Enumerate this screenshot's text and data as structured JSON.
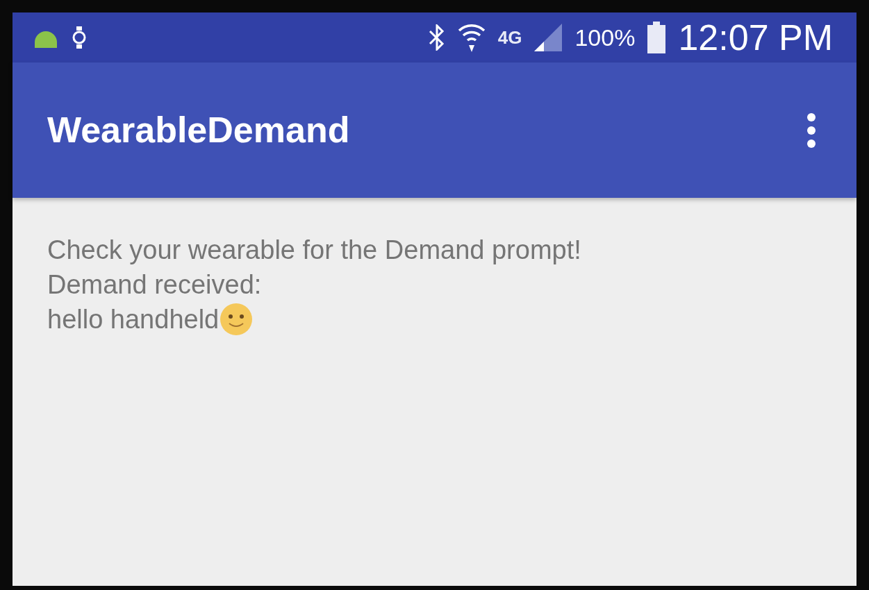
{
  "status_bar": {
    "network_label": "4G",
    "battery": "100%",
    "time": "12:07 PM"
  },
  "app_bar": {
    "title": "WearableDemand"
  },
  "content": {
    "lines": [
      {
        "text": "Check your wearable for the Demand prompt!",
        "emoji": false
      },
      {
        "text": "Demand received:",
        "emoji": false
      },
      {
        "text": "hello handheld",
        "emoji": true
      }
    ]
  }
}
